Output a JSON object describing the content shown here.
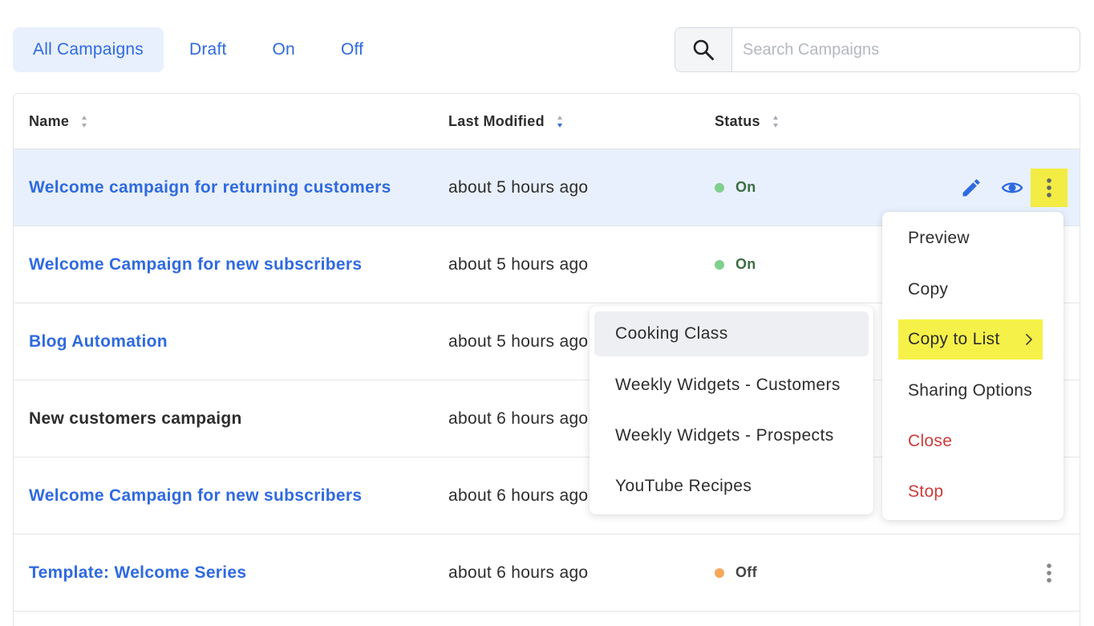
{
  "filters": {
    "tabs": [
      {
        "label": "All Campaigns",
        "active": true
      },
      {
        "label": "Draft",
        "active": false
      },
      {
        "label": "On",
        "active": false
      },
      {
        "label": "Off",
        "active": false
      }
    ]
  },
  "search": {
    "placeholder": "Search Campaigns",
    "value": "",
    "icon": "search-icon"
  },
  "table": {
    "columns": {
      "name": "Name",
      "last_modified": "Last Modified",
      "status": "Status"
    },
    "sorted_column": "last_modified",
    "rows": [
      {
        "name": "Welcome campaign for returning customers",
        "modified": "about 5 hours ago",
        "status": "On",
        "link": true
      },
      {
        "name": "Welcome Campaign for new subscribers",
        "modified": "about 5 hours ago",
        "status": "On",
        "link": true
      },
      {
        "name": "Blog Automation",
        "modified": "about 5 hours ago",
        "status": "",
        "link": true
      },
      {
        "name": "New customers campaign",
        "modified": "about 6 hours ago",
        "status": "",
        "link": false
      },
      {
        "name": "Welcome Campaign for new subscribers",
        "modified": "about 6 hours ago",
        "status": "",
        "link": true
      },
      {
        "name": "Template: Welcome Series",
        "modified": "about 6 hours ago",
        "status": "Off",
        "link": true
      }
    ]
  },
  "action_menu": {
    "items": [
      {
        "label": "Preview",
        "danger": false
      },
      {
        "label": "Copy",
        "danger": false
      },
      {
        "label": "Copy to List",
        "danger": false,
        "submenu": true
      },
      {
        "label": "Sharing Options",
        "danger": false
      },
      {
        "label": "Close",
        "danger": true
      },
      {
        "label": "Stop",
        "danger": true
      }
    ]
  },
  "list_submenu": {
    "items": [
      "Cooking Class",
      "Weekly Widgets - Customers",
      "Weekly Widgets - Prospects",
      "YouTube Recipes"
    ]
  },
  "colors": {
    "link": "#2f6ae0",
    "status_on": "#7fd08d",
    "status_off": "#f5a85a",
    "highlight": "#f2ec44",
    "danger": "#cc3b3b"
  }
}
